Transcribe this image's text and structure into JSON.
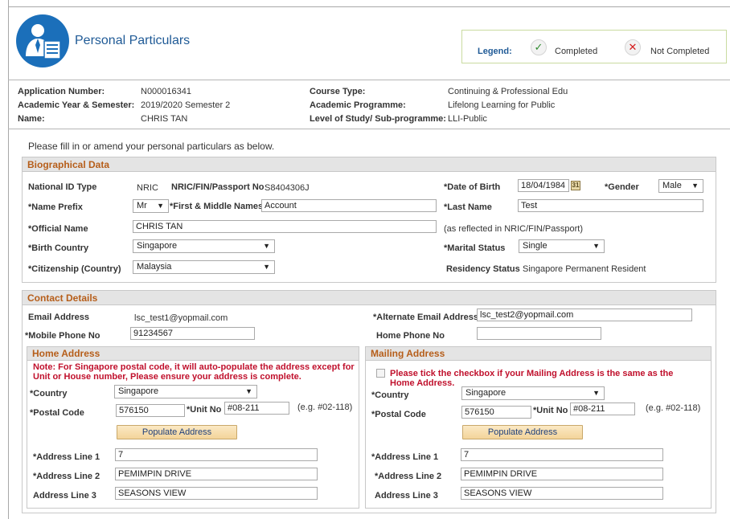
{
  "header": {
    "title": "Personal Particulars",
    "legend_label": "Legend:",
    "completed_label": "Completed",
    "not_completed_label": "Not Completed"
  },
  "application": {
    "app_number_label": "Application Number:",
    "app_number": "N000016341",
    "year_semester_label": "Academic Year & Semester:",
    "year_semester": "2019/2020 Semester 2",
    "name_label": "Name:",
    "name": "CHRIS TAN",
    "course_type_label": "Course Type:",
    "course_type": "Continuing & Professional Edu",
    "programme_label": "Academic Programme:",
    "programme": "Lifelong Learning for Public",
    "level_label": "Level of Study/ Sub-programme:",
    "level": "LLI-Public"
  },
  "instruction": "Please fill in or amend your personal particulars as below.",
  "bio": {
    "heading": "Biographical Data",
    "id_type_label": "National ID Type",
    "id_type": "NRIC",
    "id_no_label": "NRIC/FIN/Passport No",
    "id_no": "S8404306J",
    "dob_label": "*Date of Birth",
    "dob": "18/04/1984",
    "gender_label": "*Gender",
    "gender": "Male",
    "prefix_label": "*Name Prefix",
    "prefix": "Mr",
    "first_names_label": "*First & Middle Names",
    "first_names": "Account",
    "last_name_label": "*Last Name",
    "last_name": "Test",
    "official_name_label": "*Official Name",
    "official_name": "CHRIS TAN",
    "official_name_note": "(as reflected in NRIC/FIN/Passport)",
    "birth_country_label": "*Birth Country",
    "birth_country": "Singapore",
    "marital_label": "*Marital Status",
    "marital": "Single",
    "citizenship_label": "*Citizenship (Country)",
    "citizenship": "Malaysia",
    "residency_label": "Residency Status",
    "residency": "Singapore Permanent Resident"
  },
  "contact": {
    "heading": "Contact Details",
    "email_label": "Email Address",
    "email": "lsc_test1@yopmail.com",
    "alt_email_label": "*Alternate Email Address",
    "alt_email": "lsc_test2@yopmail.com",
    "mobile_label": "*Mobile Phone No",
    "mobile": "91234567",
    "home_phone_label": "Home Phone No",
    "home_phone": ""
  },
  "home_address": {
    "heading": "Home Address",
    "note": "Note: For Singapore postal code, it will auto-populate the address except for Unit or House number, Please ensure your address is complete.",
    "country_label": "*Country",
    "country": "Singapore",
    "postal_label": "*Postal Code",
    "postal": "576150",
    "unit_label": "*Unit No",
    "unit": "#08-211",
    "unit_example": "(e.g. #02-118)",
    "populate_button": "Populate Address",
    "line1_label": "*Address Line 1",
    "line1": "7",
    "line2_label": "*Address Line 2",
    "line2": "PEMIMPIN DRIVE",
    "line3_label": "Address Line 3",
    "line3": "SEASONS VIEW"
  },
  "mailing_address": {
    "heading": "Mailing Address",
    "same_note": "Please tick the checkbox if your Mailing Address is the same as the Home Address.",
    "country_label": "*Country",
    "country": "Singapore",
    "postal_label": "*Postal Code",
    "postal": "576150",
    "unit_label": "*Unit No",
    "unit": "#08-211",
    "unit_example": "(e.g. #02-118)",
    "populate_button": "Populate Address",
    "line1_label": "*Address Line 1",
    "line1": "7",
    "line2_label": "*Address Line 2",
    "line2": "PEMIMPIN DRIVE",
    "line3_label": "Address Line 3",
    "line3": "SEASONS VIEW"
  },
  "colors": {
    "section_heading": "#b65e1a",
    "title_blue": "#1f5a96",
    "note_red": "#c0102c",
    "logo_blue": "#1b6fba"
  },
  "icons": {
    "logo": "person-document-icon",
    "completed": "check-icon",
    "not_completed": "cross-icon",
    "calendar": "calendar-icon",
    "dropdown": "chevron-down-icon"
  }
}
